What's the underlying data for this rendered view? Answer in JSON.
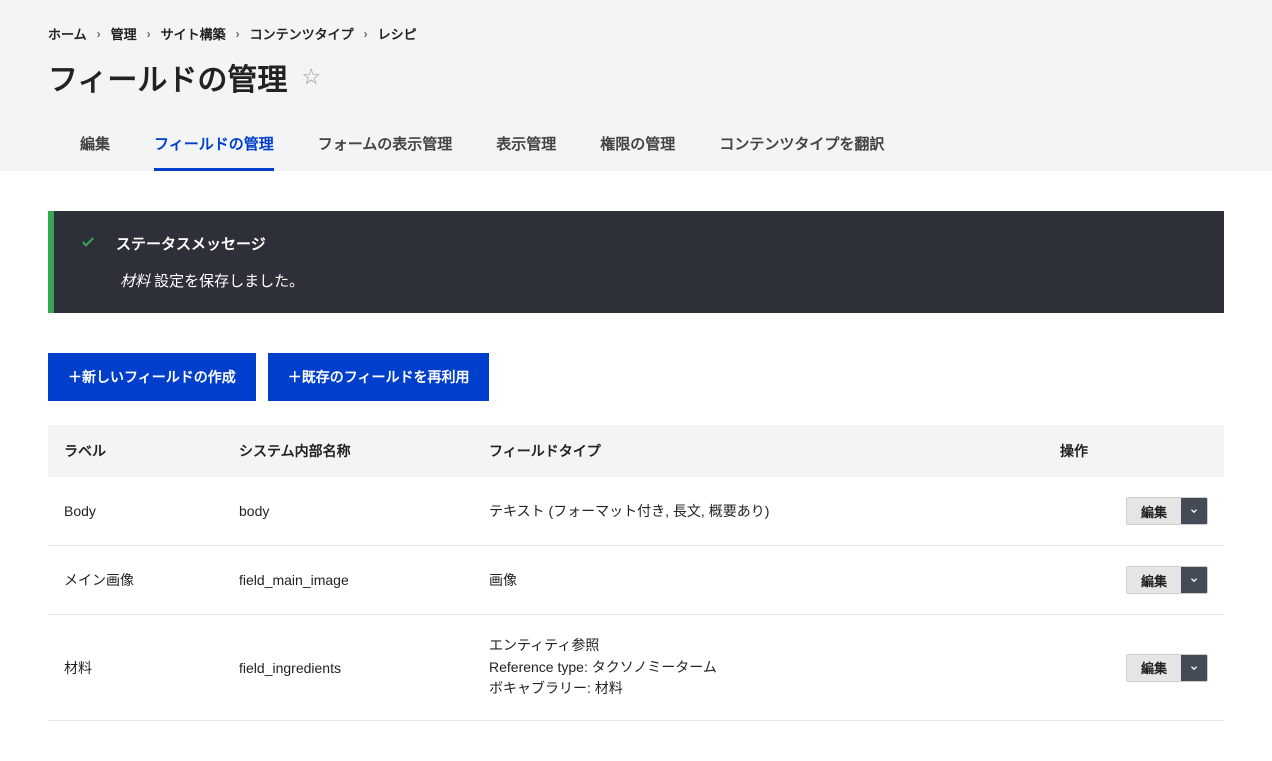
{
  "breadcrumb": [
    {
      "label": "ホーム"
    },
    {
      "label": "管理"
    },
    {
      "label": "サイト構築"
    },
    {
      "label": "コンテンツタイプ"
    },
    {
      "label": "レシピ"
    }
  ],
  "page_title": "フィールドの管理",
  "tabs": [
    {
      "label": "編集",
      "active": false
    },
    {
      "label": "フィールドの管理",
      "active": true
    },
    {
      "label": "フォームの表示管理",
      "active": false
    },
    {
      "label": "表示管理",
      "active": false
    },
    {
      "label": "権限の管理",
      "active": false
    },
    {
      "label": "コンテンツタイプを翻訳",
      "active": false
    }
  ],
  "status": {
    "title": "ステータスメッセージ",
    "entity_em": "材料",
    "body_rest": " 設定を保存しました。"
  },
  "actions": {
    "create": "＋新しいフィールドの作成",
    "reuse": "＋既存のフィールドを再利用"
  },
  "table": {
    "headers": {
      "label": "ラベル",
      "machine": "システム内部名称",
      "type": "フィールドタイプ",
      "ops": "操作"
    },
    "op_label": "編集",
    "rows": [
      {
        "label": "Body",
        "machine": "body",
        "type_lines": [
          "テキスト (フォーマット付き, 長文, 概要あり)"
        ]
      },
      {
        "label": "メイン画像",
        "machine": "field_main_image",
        "type_lines": [
          "画像"
        ]
      },
      {
        "label": "材料",
        "machine": "field_ingredients",
        "type_lines": [
          "エンティティ参照",
          "Reference type: タクソノミーターム",
          "ボキャブラリー: 材料"
        ]
      }
    ]
  }
}
